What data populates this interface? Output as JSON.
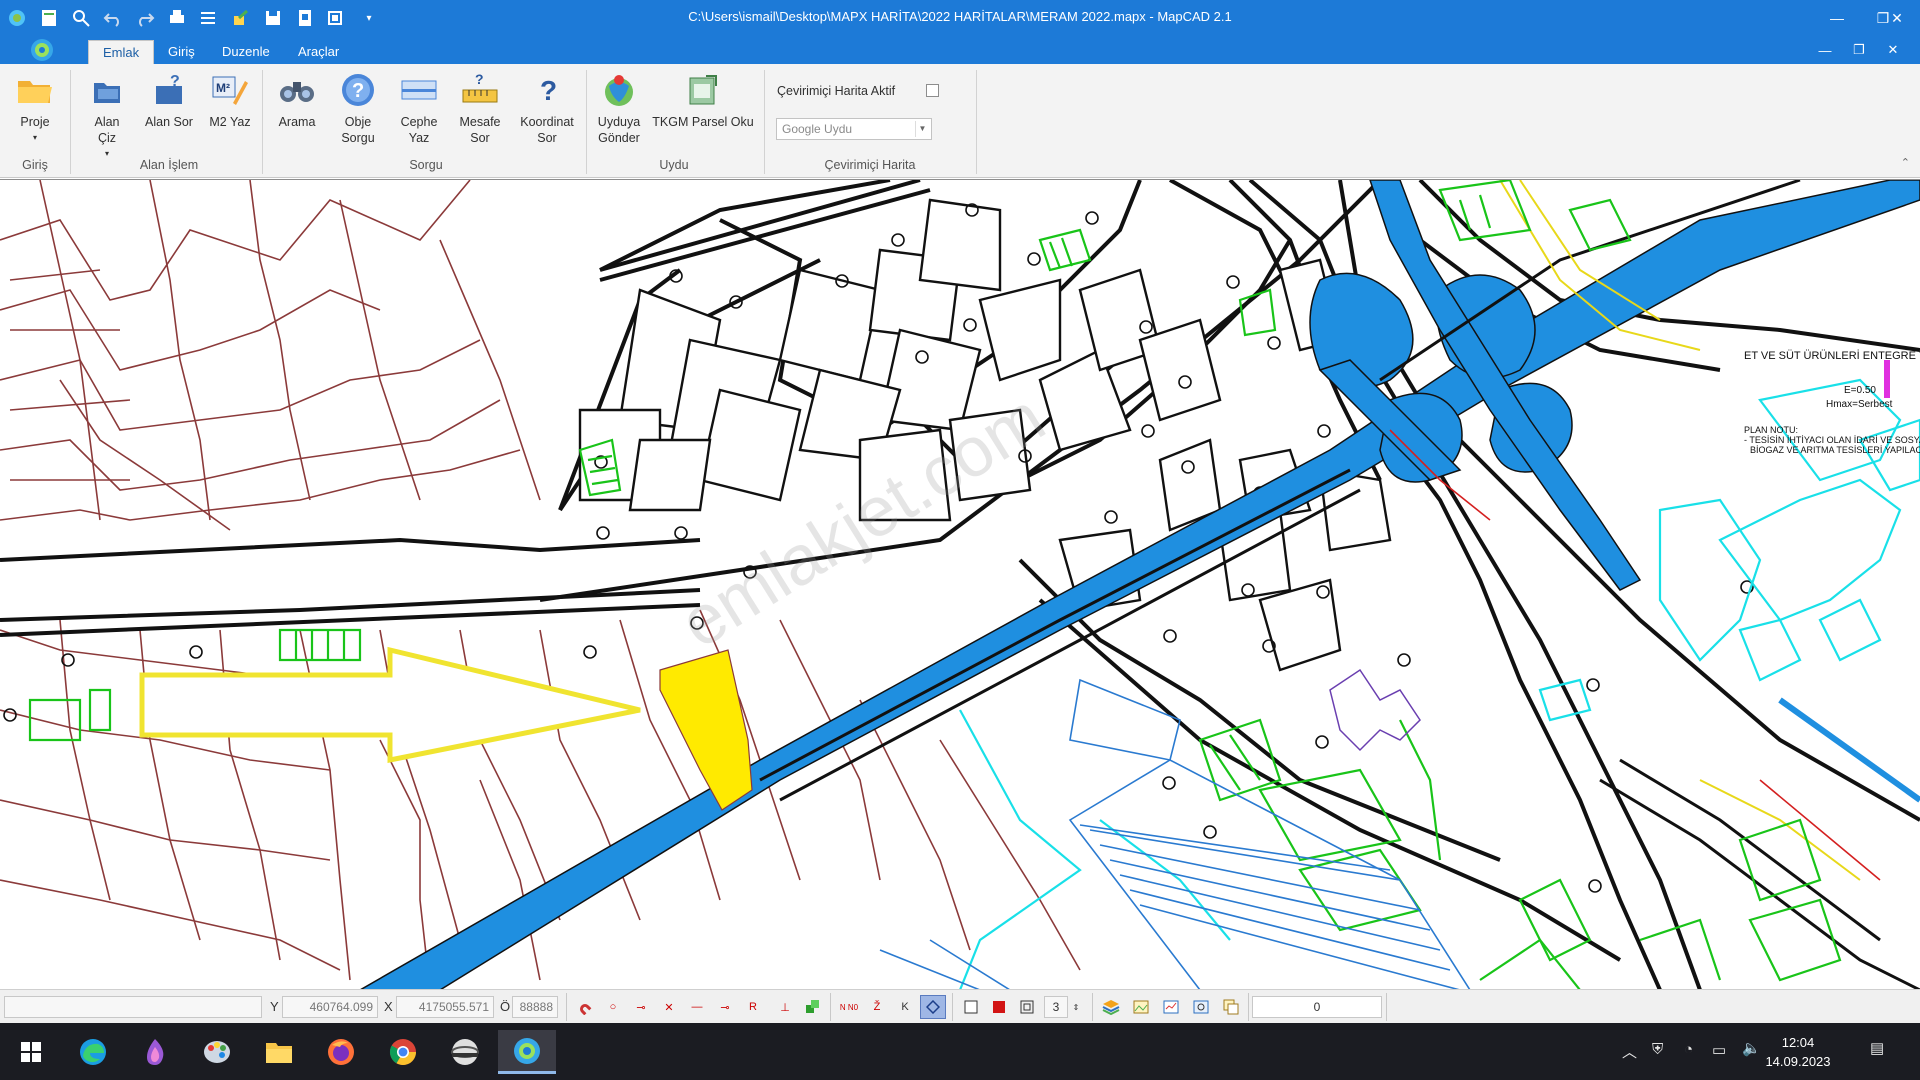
{
  "window": {
    "title": "C:\\Users\\ismail\\Desktop\\MAPX HARİTA\\2022 HARİTALAR\\MERAM 2022.mapx - MapCAD 2.1",
    "controls": {
      "minimize": "—",
      "restore": "❐",
      "close": "✕"
    }
  },
  "tabs": [
    "Emlak",
    "Giriş",
    "Duzenle",
    "Araçlar"
  ],
  "active_tab": "Emlak",
  "ribbon": {
    "buttons": {
      "proje": "Proje",
      "alan_ciz": "Alan\nÇiz",
      "alan_sor": "Alan Sor",
      "m2_yaz": "M2 Yaz",
      "arama": "Arama",
      "obje_sorgu": "Obje\nSorgu",
      "cephe_yaz": "Cephe\nYaz",
      "mesafe_sor": "Mesafe\nSor",
      "koordinat_sor": "Koordinat\nSor",
      "uyduya_gonder": "Uyduya\nGönder",
      "tkgm_parsel_oku": "TKGM Parsel Oku"
    },
    "groups": {
      "giris": "Giriş",
      "alan_islem": "Alan İşlem",
      "sorgu": "Sorgu",
      "uydu": "Uydu",
      "cevrimici": "Çevirimiçi Harita"
    },
    "online_active_label": "Çevirimiçi Harita Aktif",
    "online_active_checked": false,
    "provider_placeholder": "Google Uydu"
  },
  "map": {
    "labels": {
      "plant_title": "ET VE SÜT ÜRÜNLERİ ENTEGRE T",
      "e_value": "E=0.50",
      "hmax": "Hmax=Serbest",
      "plan_notu": "PLAN NOTU:",
      "plan_note_1": "- TESİSİN İHTİYACI OLAN İDARİ VE SOSYA",
      "plan_note_2": "BİOGAZ VE ARITMA TESİSLERİ YAPILACA"
    },
    "watermark": "emlakjet.com",
    "colors": {
      "parcel": "#8b3a3a",
      "road": "#111111",
      "highway": "#1f8fe0",
      "green_zone": "#19c419",
      "highlight_parcel": "#ffea00",
      "arrow": "#f0e430",
      "cyan_zone": "#19e0e8",
      "blue_hatch": "#2a7ad0"
    }
  },
  "status": {
    "y_label": "Y",
    "y_value": "460764.099",
    "x_label": "X",
    "x_value": "4175055.571",
    "o_label": "Ö",
    "o_value": "88888",
    "layer_count": "3",
    "right_value": "0",
    "snap_buttons": [
      "N N0",
      "Ž",
      "K"
    ]
  },
  "taskbar": {
    "clock_time": "12:04",
    "clock_date": "14.09.2023"
  }
}
